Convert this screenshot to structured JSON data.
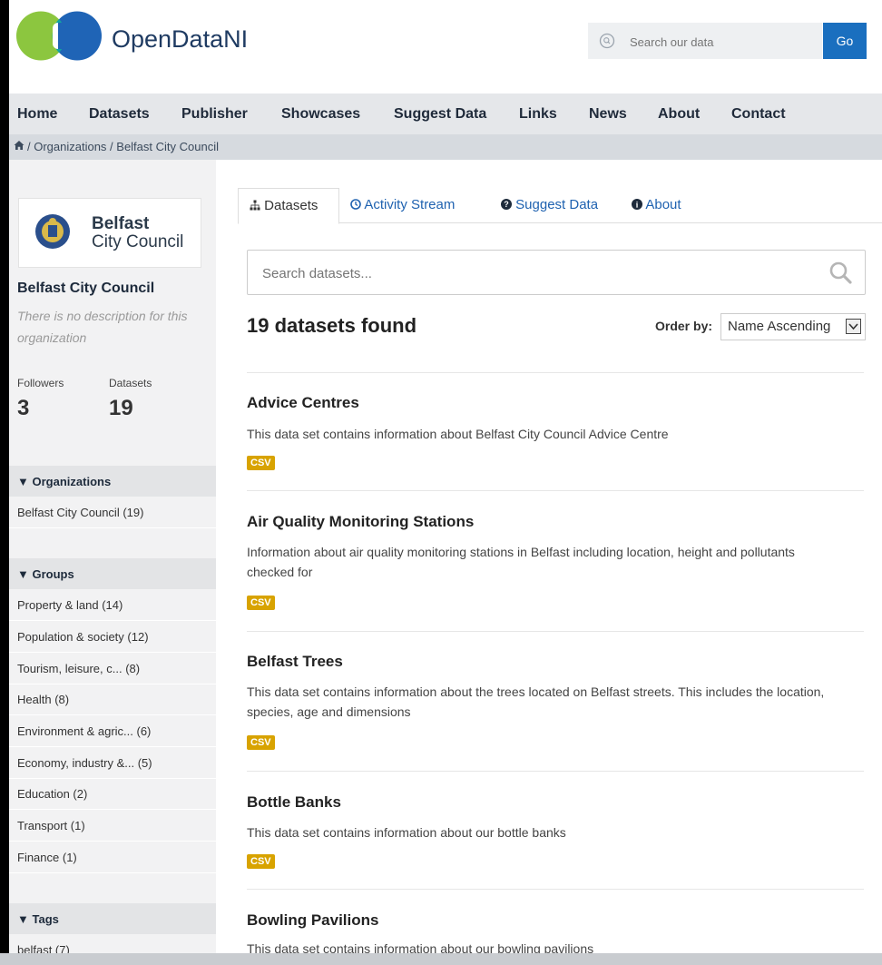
{
  "header": {
    "brand": "OpenDataNI",
    "search_placeholder": "Search our data",
    "go_label": "Go"
  },
  "nav": {
    "items": [
      "Home",
      "Datasets",
      "Publisher",
      "Showcases",
      "Suggest Data",
      "Links",
      "News",
      "About",
      "Contact"
    ]
  },
  "breadcrumb": "/ Organizations / Belfast City Council",
  "sidebar": {
    "org_logo_line1": "Belfast",
    "org_logo_line2": "City Council",
    "org_name": "Belfast City Council",
    "description": "There is no description for this organization",
    "followers_label": "Followers",
    "followers_value": "3",
    "datasets_label": "Datasets",
    "datasets_value": "19",
    "organizations_heading": "Organizations",
    "organizations": [
      "Belfast City Council (19)"
    ],
    "groups_heading": "Groups",
    "groups": [
      "Property & land (14)",
      "Population & society (12)",
      "Tourism, leisure, c... (8)",
      "Health (8)",
      "Environment & agric... (6)",
      "Economy, industry &... (5)",
      "Education (2)",
      "Transport (1)",
      "Finance (1)"
    ],
    "tags_heading": "Tags",
    "tags": [
      "belfast (7)"
    ]
  },
  "tabs": {
    "datasets": "Datasets",
    "activity": "Activity Stream",
    "suggest": "Suggest Data",
    "about": "About"
  },
  "search": {
    "placeholder": "Search datasets..."
  },
  "results": {
    "count_text": "19 datasets found",
    "order_label": "Order by:",
    "order_value": "Name Ascending"
  },
  "datasets": [
    {
      "title": "Advice Centres",
      "description": "This data set contains information about Belfast City Council Advice Centre",
      "format": "CSV"
    },
    {
      "title": "Air Quality Monitoring Stations",
      "description": "Information about air quality monitoring stations in Belfast including location, height and pollutants checked for",
      "format": "CSV"
    },
    {
      "title": "Belfast Trees",
      "description": "This data set contains information about the trees located on Belfast streets. This includes the location, species, age and dimensions",
      "format": "CSV"
    },
    {
      "title": "Bottle Banks",
      "description": "This data set contains information about our bottle banks",
      "format": "CSV"
    },
    {
      "title": "Bowling Pavilions",
      "description": "This data set contains information about our bowling pavilions"
    }
  ],
  "colors": {
    "accent": "#1a6fbf",
    "link": "#1f62b0",
    "csv_badge": "#d8a300",
    "nav_bg": "#e5e7ea"
  }
}
